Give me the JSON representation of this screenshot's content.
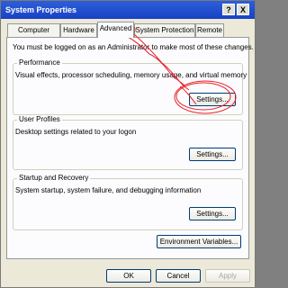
{
  "window": {
    "title": "System Properties",
    "help_glyph": "?",
    "close_glyph": "X"
  },
  "tabs": [
    {
      "label": "Computer Name"
    },
    {
      "label": "Hardware"
    },
    {
      "label": "Advanced"
    },
    {
      "label": "System Protection"
    },
    {
      "label": "Remote"
    }
  ],
  "admin_notice": "You must be logged on as an Administrator to make most of these changes.",
  "performance": {
    "label": "Performance",
    "description": "Visual effects, processor scheduling, memory usage, and virtual memory",
    "button": "Settings..."
  },
  "user_profiles": {
    "label": "User Profiles",
    "description": "Desktop settings related to your logon",
    "button": "Settings..."
  },
  "startup_recovery": {
    "label": "Startup and Recovery",
    "description": "System startup, system failure, and debugging information",
    "button": "Settings..."
  },
  "env_button": "Environment Variables...",
  "footer": {
    "ok": "OK",
    "cancel": "Cancel",
    "apply": "Apply"
  },
  "colors": {
    "title_bar": "#1f4ed0",
    "scribble": "#e8202a"
  }
}
